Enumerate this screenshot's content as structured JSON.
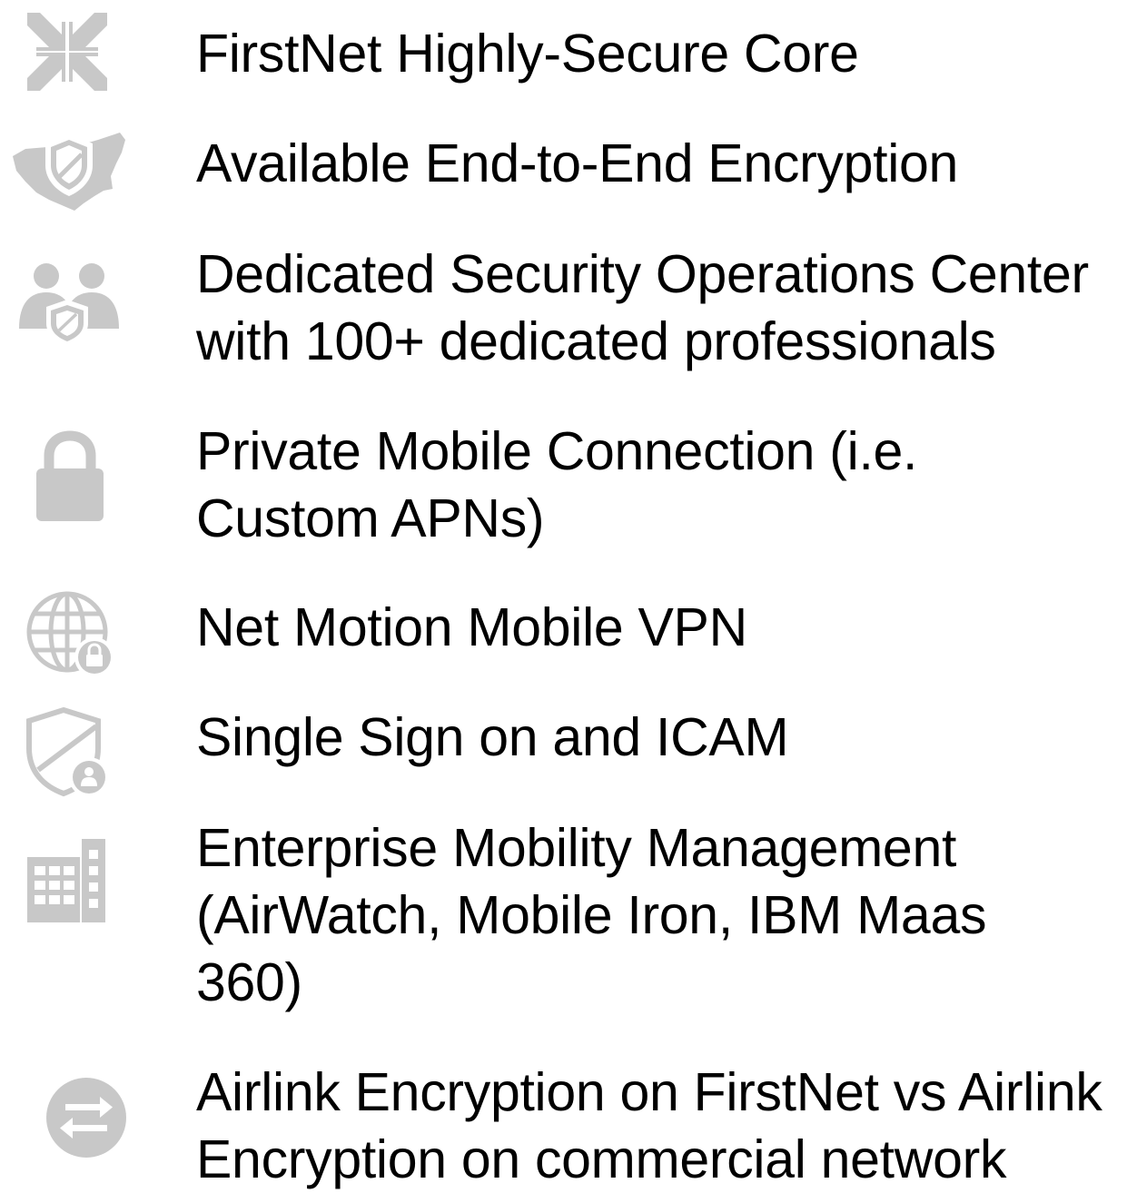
{
  "accent_color": "#c8c8c8",
  "text_color": "#000000",
  "items": [
    {
      "icon": "compress-arrows-icon",
      "lines": [
        "FirstNet Highly-Secure Core"
      ]
    },
    {
      "icon": "us-map-shield-icon",
      "lines": [
        "Available End-to-End Encryption"
      ]
    },
    {
      "icon": "people-shield-icon",
      "lines": [
        "Dedicated Security Operations Center",
        "with 100+ dedicated professionals"
      ]
    },
    {
      "icon": "padlock-icon",
      "lines": [
        "Private Mobile Connection (i.e.",
        "Custom APNs)"
      ]
    },
    {
      "icon": "globe-lock-icon",
      "lines": [
        "Net Motion Mobile VPN"
      ]
    },
    {
      "icon": "shield-user-icon",
      "lines": [
        "Single Sign on and ICAM"
      ]
    },
    {
      "icon": "building-icon",
      "lines": [
        "Enterprise Mobility Management",
        "(AirWatch, Mobile Iron, IBM Maas",
        "360)"
      ]
    },
    {
      "icon": "exchange-arrows-icon",
      "lines": [
        "Airlink Encryption on FirstNet vs Airlink",
        "Encryption on commercial network"
      ]
    }
  ]
}
